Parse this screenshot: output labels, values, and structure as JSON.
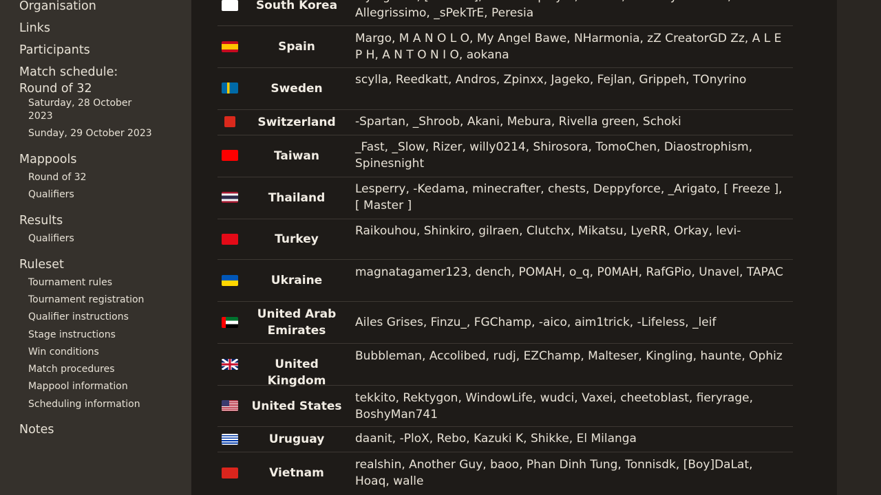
{
  "sidebar": {
    "organisation": "Organisation",
    "links": "Links",
    "participants": "Participants",
    "match_schedule": "Match schedule:",
    "round_of_32": "Round of 32",
    "sat": "Saturday, 28 October 2023",
    "sun": "Sunday, 29 October 2023",
    "mappools": "Mappools",
    "mp_ro32": "Round of 32",
    "mp_qual": "Qualifiers",
    "results": "Results",
    "res_qual": "Qualifiers",
    "ruleset": "Ruleset",
    "rules": [
      "Tournament rules",
      "Tournament registration",
      "Qualifier instructions",
      "Stage instructions",
      "Win conditions",
      "Match procedures",
      "Mappool information",
      "Scheduling information"
    ],
    "notes": "Notes"
  },
  "rows": [
    {
      "country": "South Korea",
      "players": "Flyingtuna, [Karcher], worst hr player, -Kestia, Amamiya Kokoro, Allegrissimo, _sPekTrE, Peresia"
    },
    {
      "country": "Spain",
      "players": "Margo, M A N O L O, My Angel Bawe, NHarmonia, zZ CreatorGD Zz, A L E P H, A N T O N I O, aokana"
    },
    {
      "country": "Sweden",
      "players": "scylla, Reedkatt, Andros, Zpinxx, Jageko, Fejlan, Grippeh, TOnyrino"
    },
    {
      "country": "Switzerland",
      "players": "-Spartan, _Shroob, Akani, Mebura, Rivella green, Schoki"
    },
    {
      "country": "Taiwan",
      "players": "_Fast, _Slow, Rizer, willy0214, Shirosora, TomoChen, Diaostrophism, Spinesnight"
    },
    {
      "country": "Thailand",
      "players": "Lesperry, -Kedama, minecrafter, chests, Deppyforce, _Arigato, [ Freeze ], [ Master ]"
    },
    {
      "country": "Turkey",
      "players": "Raikouhou, Shinkiro, gilraen, Clutchx, Mikatsu, LyeRR, Orkay, levi-"
    },
    {
      "country": "Ukraine",
      "players": "magnatagamer123, dench, POMAH, o_q, P0MAH, RafGPio, Unavel, TAPAC"
    },
    {
      "country": "United Arab Emirates",
      "players": "Ailes Grises, Finzu_, FGChamp, -aico, aim1trick, -Lifeless, _leif"
    },
    {
      "country": "United Kingdom",
      "players": "Bubbleman, Accolibed, rudj, EZChamp, Malteser, Kingling, haunte, Ophiz"
    },
    {
      "country": "United States",
      "players": "tekkito, Rektygon, WindowLife, wudci, Vaxei, cheetoblast, fieryrage, BoshyMan741"
    },
    {
      "country": "Uruguay",
      "players": "daanit, -PloX, Rebo, Kazuki K, Shikke, El Milanga"
    },
    {
      "country": "Vietnam",
      "players": "realshin, Another Guy, baoo, Phan Dinh Tung, Tonnisdk, [Boy]DaLat, Hoaq, walle"
    }
  ]
}
